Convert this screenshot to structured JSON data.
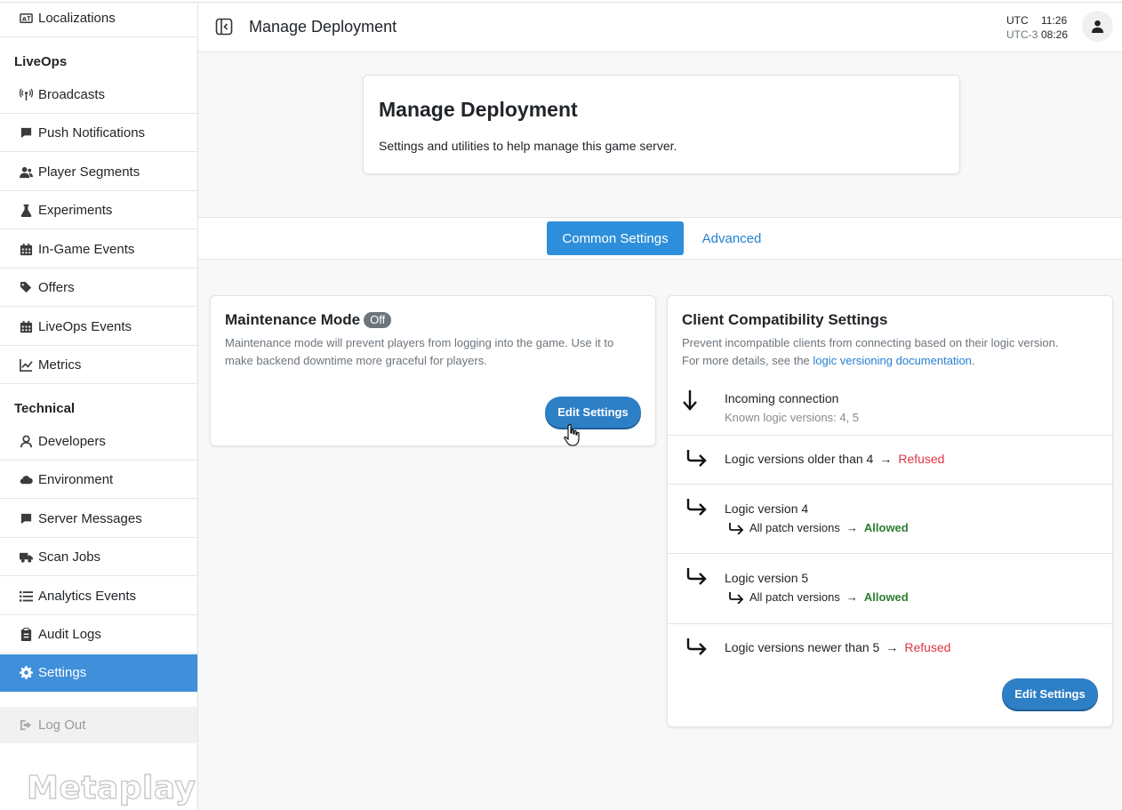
{
  "sidebar": {
    "items_top": [
      {
        "label": "Localizations",
        "icon": "localization-icon"
      }
    ],
    "liveops_heading": "LiveOps",
    "liveops_items": [
      {
        "label": "Broadcasts",
        "icon": "broadcast-icon"
      },
      {
        "label": "Push Notifications",
        "icon": "comment-icon"
      },
      {
        "label": "Player Segments",
        "icon": "user-group-icon"
      },
      {
        "label": "Experiments",
        "icon": "flask-icon"
      },
      {
        "label": "In-Game Events",
        "icon": "calendar-icon"
      },
      {
        "label": "Offers",
        "icon": "tags-icon"
      },
      {
        "label": "LiveOps Events",
        "icon": "calendar-icon"
      },
      {
        "label": "Metrics",
        "icon": "chart-line-icon"
      }
    ],
    "technical_heading": "Technical",
    "technical_items": [
      {
        "label": "Developers",
        "icon": "developer-icon"
      },
      {
        "label": "Environment",
        "icon": "cloud-icon"
      },
      {
        "label": "Server Messages",
        "icon": "comment-icon"
      },
      {
        "label": "Scan Jobs",
        "icon": "truck-icon"
      },
      {
        "label": "Analytics Events",
        "icon": "list-icon"
      },
      {
        "label": "Audit Logs",
        "icon": "clipboard-icon"
      },
      {
        "label": "Settings",
        "icon": "gear-icon",
        "active": true
      }
    ],
    "logout_label": "Log Out",
    "logo_text": "Metaplay"
  },
  "header": {
    "title": "Manage Deployment",
    "tz_label_1": "UTC",
    "tz_label_2": "UTC-3",
    "tz_time_1": "11:26",
    "tz_time_2": "08:26"
  },
  "overview": {
    "title": "Manage Deployment",
    "description": "Settings and utilities to help manage this game server."
  },
  "tabs": {
    "common": "Common Settings",
    "advanced": "Advanced"
  },
  "maintenance": {
    "title": "Maintenance Mode",
    "badge": "Off",
    "description": "Maintenance mode will prevent players from logging into the game. Use it to make backend downtime more graceful for players.",
    "button": "Edit Settings"
  },
  "compat": {
    "title": "Client Compatibility Settings",
    "description_1": "Prevent incompatible clients from connecting based on their logic version.",
    "description_2_prefix": "For more details, see the ",
    "description_link": "logic versioning documentation",
    "description_2_suffix": ".",
    "incoming_title": "Incoming connection",
    "incoming_sub": "Known logic versions: 4, 5",
    "rows": [
      {
        "label": "Logic versions older than 4",
        "status": "Refused"
      },
      {
        "label": "Logic version 4",
        "sub_label": "All patch versions",
        "sub_status": "Allowed"
      },
      {
        "label": "Logic version 5",
        "sub_label": "All patch versions",
        "sub_status": "Allowed"
      },
      {
        "label": "Logic versions newer than 5",
        "status": "Refused"
      }
    ],
    "button": "Edit Settings"
  },
  "colors": {
    "accent": "#3f8fdb",
    "refused": "#dc3545",
    "allowed": "#2e7d32"
  }
}
